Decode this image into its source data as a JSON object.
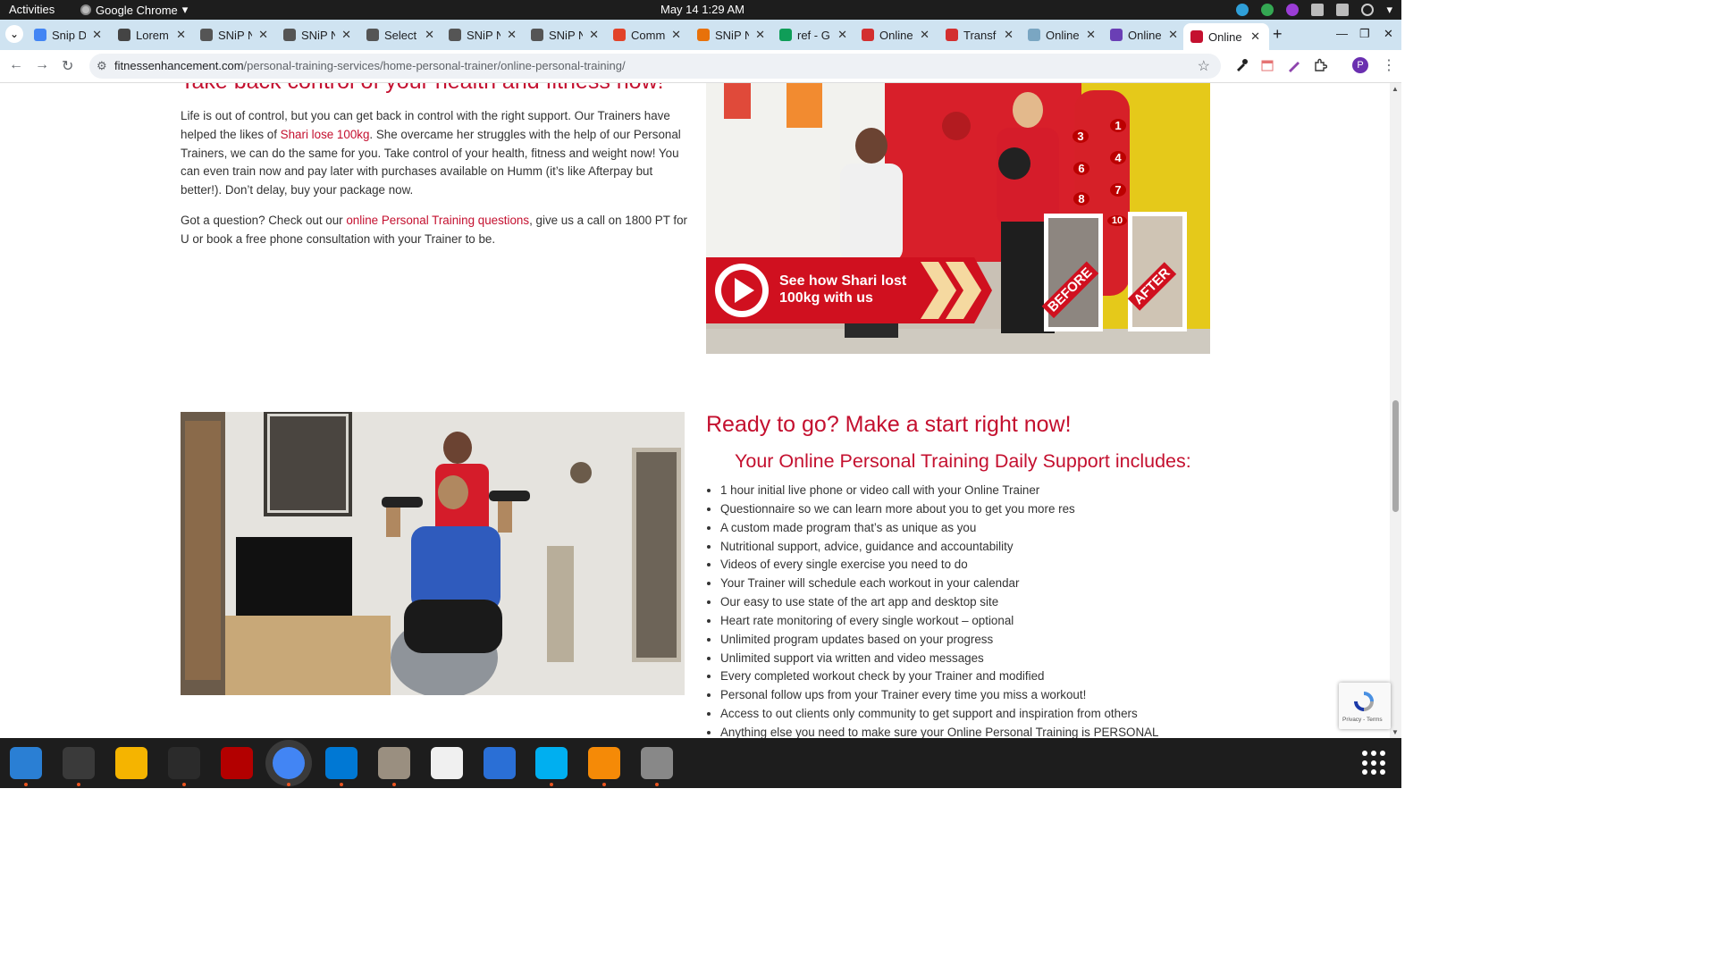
{
  "system_bar": {
    "activities": "Activities",
    "app_name": "Google Chrome",
    "clock": "May 14  1:29 AM"
  },
  "tabs": [
    {
      "label": "Snip D",
      "icon": "docs-icon",
      "color": "#4285f4"
    },
    {
      "label": "Lorem",
      "icon": "lorem-icon",
      "color": "#444444"
    },
    {
      "label": "SNiP N",
      "icon": "snip-icon",
      "color": "#555555"
    },
    {
      "label": "SNiP N",
      "icon": "snip-icon",
      "color": "#555555"
    },
    {
      "label": "Select",
      "icon": "globe-icon",
      "color": "#555555"
    },
    {
      "label": "SNiP N",
      "icon": "snip-icon",
      "color": "#555555"
    },
    {
      "label": "SNiP N",
      "icon": "snip-icon",
      "color": "#555555"
    },
    {
      "label": "Comm",
      "icon": "gitlab-icon",
      "color": "#e24329"
    },
    {
      "label": "SNiP N",
      "icon": "snip-orange-icon",
      "color": "#e8710a"
    },
    {
      "label": "ref - G",
      "icon": "sheets-icon",
      "color": "#0f9d58"
    },
    {
      "label": "Online",
      "icon": "red-square-icon",
      "color": "#d32f2f"
    },
    {
      "label": "Transf",
      "icon": "red-square-icon",
      "color": "#d32f2f"
    },
    {
      "label": "Online",
      "icon": "wp-icon",
      "color": "#7aa6c2"
    },
    {
      "label": "Online",
      "icon": "purple-icon",
      "color": "#6a3fb5"
    },
    {
      "label": "Online",
      "icon": "fe-icon",
      "color": "#c4102f",
      "active": true
    }
  ],
  "address_bar": {
    "url_domain": "fitnessenhancement.com",
    "url_path": "/personal-training-services/home-personal-trainer/online-personal-training/"
  },
  "profile_initial": "P",
  "section1": {
    "heading": "Take back control of your health and fitness now!",
    "p1_before": "Life is out of control, but you can get back in control with the right support. Our Trainers have helped the likes of ",
    "p1_link": "Shari lose 100kg",
    "p1_after": ". She overcame her struggles with the help of our Personal Trainers, we can do the same for you. Take control of your health, fitness and weight now! You can even train now and pay later with purchases available on Humm (it’s like Afterpay but better!). Don’t delay, buy your package now.",
    "p2_before": "Got a question? Check out our ",
    "p2_link": "online Personal Training questions",
    "p2_after": ", give us a call on 1800 PT for U or book a free phone consultation with your Trainer to be."
  },
  "banner": {
    "play_text_line1": "See how Shari lost",
    "play_text_line2": "100kg with us",
    "before_label": "BEFORE",
    "after_label": "AFTER",
    "bag_numbers": [
      "3",
      "1",
      "6",
      "4",
      "8",
      "7",
      "10"
    ]
  },
  "section2": {
    "heading": "Ready to go? Make a start right now!",
    "subheading": "Your Online Personal Training Daily Support includes:",
    "features": [
      "1 hour initial live phone or video call with your Online Trainer",
      "Questionnaire so we can learn more about you to get you more res",
      "A custom made program that’s as unique as you",
      "Nutritional support, advice, guidance and accountability",
      "Videos of every single exercise you need to do",
      "Your Trainer will schedule each workout in your calendar",
      "Our easy to use state of the art app and desktop site",
      "Heart rate monitoring of every single workout – optional",
      "Unlimited program updates based on your progress",
      "Unlimited support via written and video messages",
      "Every completed workout check by your Trainer and modified",
      "Personal follow ups from your Trainer every time you miss a workout!",
      "Access to out clients only community to get support and inspiration from others",
      "Anything else you need to make sure your Online Personal Training is PERSONAL"
    ]
  },
  "recaptcha": {
    "footer": "Privacy - Terms"
  },
  "dock": [
    {
      "name": "thunderbird-icon",
      "color": "#2a7fd4"
    },
    {
      "name": "terminal-icon",
      "color": "#3a3a3a"
    },
    {
      "name": "calculator-icon",
      "color": "#f5b400"
    },
    {
      "name": "system-monitor-icon",
      "color": "#2b2b2b"
    },
    {
      "name": "filezilla-icon",
      "color": "#b30000"
    },
    {
      "name": "chrome-icon",
      "color": "#4285f4"
    },
    {
      "name": "vscode-icon",
      "color": "#0078d4"
    },
    {
      "name": "files-icon",
      "color": "#9a8f80"
    },
    {
      "name": "text-editor-icon",
      "color": "#f0f0f0"
    },
    {
      "name": "libreoffice-writer-icon",
      "color": "#2a6fd6"
    },
    {
      "name": "skype-icon",
      "color": "#00aff0"
    },
    {
      "name": "blender-icon",
      "color": "#f58a07"
    },
    {
      "name": "disks-icon",
      "color": "#888888"
    }
  ]
}
